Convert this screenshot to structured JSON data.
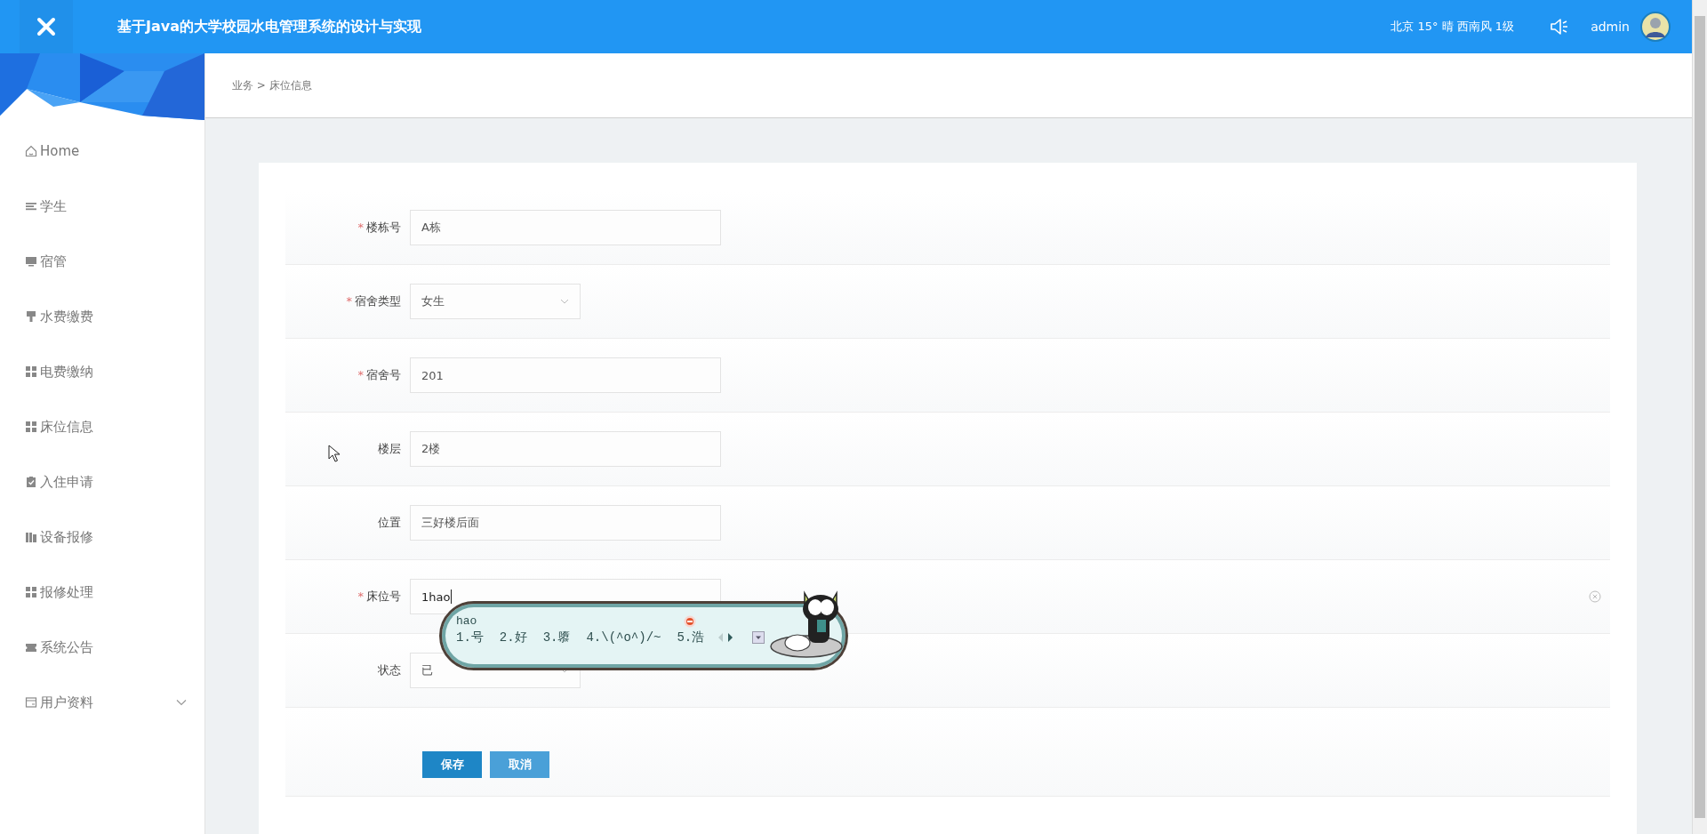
{
  "header": {
    "title": "基于Java的大学校园水电管理系统的设计与实现",
    "weather": "北京 15° 晴 西南风 1级",
    "user": "admin"
  },
  "sidebar": {
    "items": [
      {
        "label": "Home",
        "kind": "home",
        "expandable": false
      },
      {
        "label": "学生",
        "kind": "list",
        "expandable": false
      },
      {
        "label": "宿管",
        "kind": "monitor",
        "expandable": false
      },
      {
        "label": "水费缴费",
        "kind": "brush",
        "expandable": false
      },
      {
        "label": "电费缴纳",
        "kind": "grid",
        "expandable": false
      },
      {
        "label": "床位信息",
        "kind": "grid",
        "expandable": false
      },
      {
        "label": "入住申请",
        "kind": "clipboard",
        "expandable": false
      },
      {
        "label": "设备报修",
        "kind": "bars",
        "expandable": false
      },
      {
        "label": "报修处理",
        "kind": "grid",
        "expandable": false
      },
      {
        "label": "系统公告",
        "kind": "ticket",
        "expandable": false
      },
      {
        "label": "用户资料",
        "kind": "card",
        "expandable": true
      }
    ]
  },
  "breadcrumb": "业务 > 床位信息",
  "form": {
    "required_mark": "*",
    "fields": [
      {
        "label": "楼栋号",
        "required": true,
        "kind": "input",
        "value": "A栋",
        "focused": false
      },
      {
        "label": "宿舍类型",
        "required": true,
        "kind": "select",
        "value": "女生",
        "focused": false
      },
      {
        "label": "宿舍号",
        "required": true,
        "kind": "input",
        "value": "201",
        "focused": false
      },
      {
        "label": "楼层",
        "required": false,
        "kind": "input",
        "value": "2楼",
        "focused": false
      },
      {
        "label": "位置",
        "required": false,
        "kind": "input",
        "value": "三好楼后面",
        "focused": false
      },
      {
        "label": "床位号",
        "required": true,
        "kind": "input",
        "value": "1hao",
        "focused": true
      },
      {
        "label": "状态",
        "required": false,
        "kind": "select",
        "value": "已",
        "focused": false
      }
    ],
    "buttons": [
      {
        "label": "保存",
        "kind": "primary"
      },
      {
        "label": "取消",
        "kind": "secondary"
      }
    ]
  },
  "ime": {
    "composition": "hao",
    "candidates": [
      "1.号",
      "2.好",
      "3.隳",
      "4.\\(^o^)/~",
      "5.浩"
    ]
  }
}
